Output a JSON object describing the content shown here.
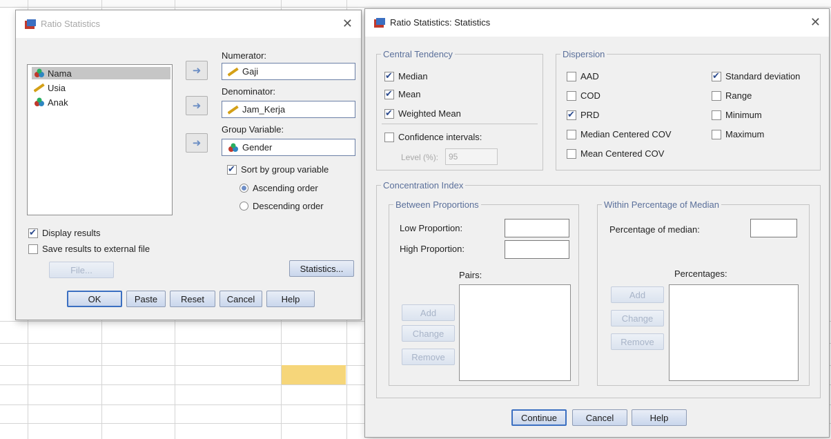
{
  "spreadsheet": {
    "highlight_color": "#f6d67a"
  },
  "ratio_dialog": {
    "title": "Ratio Statistics",
    "close_icon": "close-icon",
    "variables": [
      {
        "name": "Nama",
        "icon": "nominal-icon"
      },
      {
        "name": "Usia",
        "icon": "scale-ruler-icon"
      },
      {
        "name": "Anak",
        "icon": "nominal-icon"
      }
    ],
    "numerator_label": "Numerator:",
    "numerator_value": "Gaji",
    "denominator_label": "Denominator:",
    "denominator_value": "Jam_Kerja",
    "group_label": "Group Variable:",
    "group_value": "Gender",
    "sort_label": "Sort by group variable",
    "ascending_label": "Ascending order",
    "descending_label": "Descending order",
    "display_results_label": "Display results",
    "save_results_label": "Save results to external file",
    "file_button": "File...",
    "statistics_button": "Statistics...",
    "ok_button": "OK",
    "paste_button": "Paste",
    "reset_button": "Reset",
    "cancel_button": "Cancel",
    "help_button": "Help"
  },
  "stats_dialog": {
    "title": "Ratio Statistics: Statistics",
    "central_tendency": {
      "legend": "Central Tendency",
      "median": "Median",
      "mean": "Mean",
      "weighted_mean": "Weighted Mean",
      "confidence_intervals": "Confidence intervals:",
      "level_label": "Level (%):",
      "level_value": "95"
    },
    "dispersion": {
      "legend": "Dispersion",
      "aad": "AAD",
      "cod": "COD",
      "prd": "PRD",
      "median_cov": "Median Centered COV",
      "mean_cov": "Mean Centered COV",
      "std_dev": "Standard deviation",
      "range": "Range",
      "minimum": "Minimum",
      "maximum": "Maximum"
    },
    "concentration": {
      "legend": "Concentration Index",
      "between": {
        "legend": "Between Proportions",
        "low": "Low Proportion:",
        "high": "High Proportion:",
        "pairs": "Pairs:",
        "add": "Add",
        "change": "Change",
        "remove": "Remove"
      },
      "within": {
        "legend": "Within Percentage of Median",
        "percentage_label": "Percentage of median:",
        "percentages": "Percentages:",
        "add": "Add",
        "change": "Change",
        "remove": "Remove"
      }
    },
    "continue_button": "Continue",
    "cancel_button": "Cancel",
    "help_button": "Help"
  }
}
